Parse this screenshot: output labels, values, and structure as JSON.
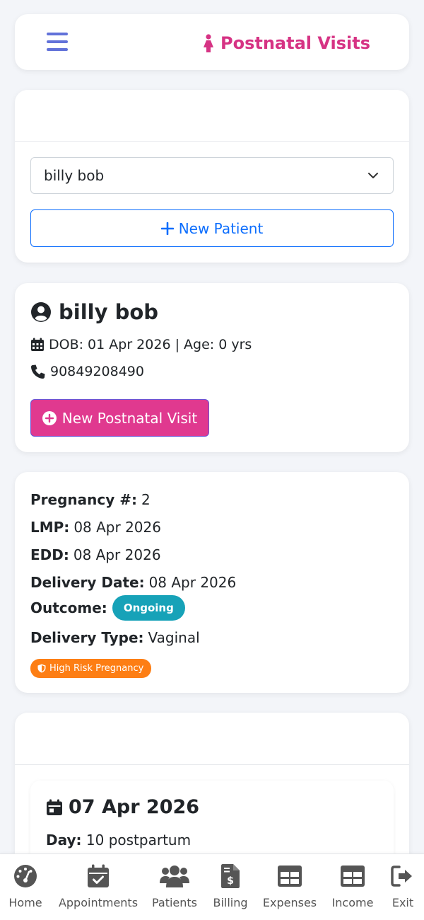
{
  "header": {
    "title": "Postnatal Visits",
    "menu_icon": "hamburger-icon",
    "title_icon": "female-figure-icon"
  },
  "patient_select": {
    "selected": "billy bob",
    "new_patient_label": "New Patient"
  },
  "patient": {
    "name": "billy bob",
    "dob_line": "DOB: 01 Apr 2026 | Age: 0 yrs",
    "phone": "90849208490",
    "new_visit_label": "New Postnatal Visit"
  },
  "pregnancy": {
    "number_label": "Pregnancy #:",
    "number": "2",
    "lmp_label": "LMP:",
    "lmp": "08 Apr 2026",
    "edd_label": "EDD:",
    "edd": "08 Apr 2026",
    "delivery_date_label": "Delivery Date:",
    "delivery_date": "08 Apr 2026",
    "outcome_label": "Outcome:",
    "outcome": "Ongoing",
    "delivery_type_label": "Delivery Type:",
    "delivery_type": "Vaginal",
    "risk_badge": "High Risk Pregnancy"
  },
  "visit": {
    "date": "07 Apr 2026",
    "day_label": "Day:",
    "day": "10 postpartum"
  },
  "nav": {
    "home": "Home",
    "appointments": "Appointments",
    "patients": "Patients",
    "billing": "Billing",
    "expenses": "Expenses",
    "income": "Income",
    "exit": "Exit"
  },
  "colors": {
    "accent_pink": "#d63384",
    "primary_blue": "#0d6efd",
    "outcome_teal": "#17a2b8",
    "risk_orange": "#fd7e14",
    "menu_indigo": "#6272d9"
  }
}
